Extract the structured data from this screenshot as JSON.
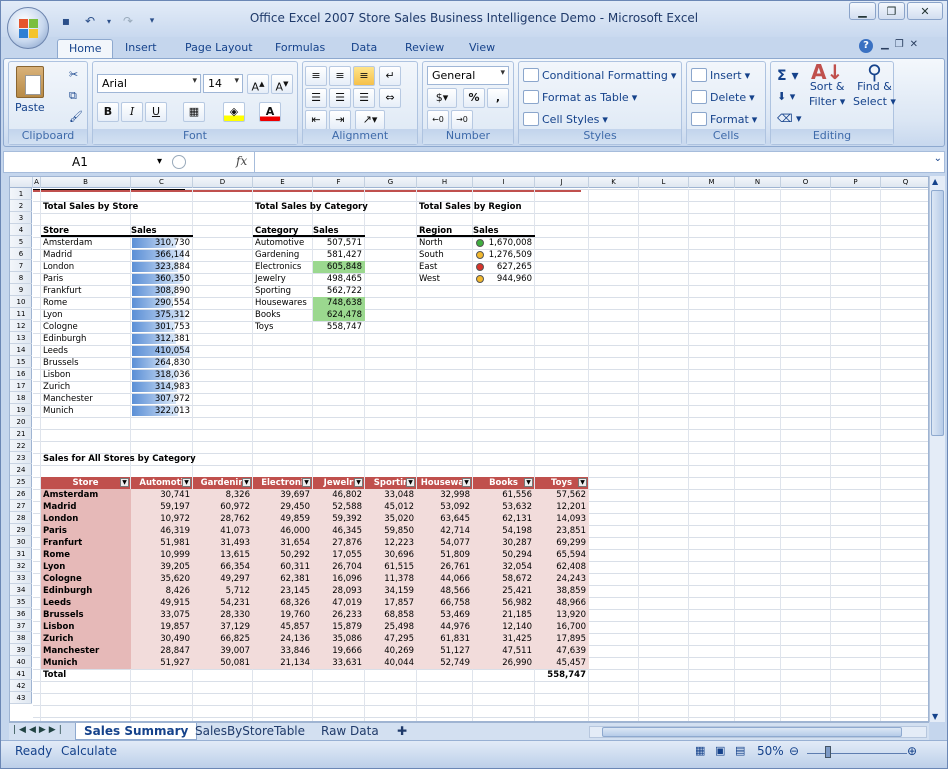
{
  "window": {
    "title": "Office Excel  2007 Store Sales Business Intelligence Demo - Microsoft Excel"
  },
  "tabs": [
    "Home",
    "Insert",
    "Page Layout",
    "Formulas",
    "Data",
    "Review",
    "View"
  ],
  "ribbon": {
    "clipboard": {
      "label": "Clipboard",
      "paste": "Paste"
    },
    "font": {
      "label": "Font",
      "name": "Arial",
      "size": "14"
    },
    "alignment": {
      "label": "Alignment"
    },
    "number": {
      "label": "Number",
      "format": "General",
      "percent": "%",
      "comma": ","
    },
    "styles": {
      "label": "Styles",
      "conditional": "Conditional Formatting",
      "table": "Format as Table",
      "cell": "Cell Styles"
    },
    "cells": {
      "label": "Cells",
      "insert": "Insert",
      "delete": "Delete",
      "format": "Format"
    },
    "editing": {
      "label": "Editing",
      "sort": "Sort &",
      "sort2": "Filter",
      "find": "Find &",
      "find2": "Select"
    }
  },
  "formula_bar": {
    "namebox": "A1",
    "fx": "fx"
  },
  "columns": [
    "A",
    "B",
    "C",
    "D",
    "E",
    "F",
    "G",
    "H",
    "I",
    "J",
    "K",
    "L",
    "M",
    "N",
    "O",
    "P",
    "Q"
  ],
  "rows": [
    "1",
    "2",
    "3",
    "4",
    "5",
    "6",
    "7",
    "8",
    "9",
    "10",
    "11",
    "12",
    "13",
    "14",
    "15",
    "16",
    "17",
    "18",
    "19",
    "20",
    "21",
    "22",
    "23",
    "24",
    "25",
    "26",
    "27",
    "28",
    "29",
    "30",
    "31",
    "32",
    "33",
    "34",
    "35",
    "36",
    "37",
    "38",
    "39",
    "40",
    "41",
    "42",
    "43"
  ],
  "store_summary": {
    "title": "Total Sales by Store",
    "col1": "Store",
    "col2": "Sales",
    "rows": [
      {
        "name": "Amsterdam",
        "value": "310,730",
        "v": 310730
      },
      {
        "name": "Madrid",
        "value": "366,144",
        "v": 366144
      },
      {
        "name": "London",
        "value": "323,884",
        "v": 323884
      },
      {
        "name": "Paris",
        "value": "360,350",
        "v": 360350
      },
      {
        "name": "Frankfurt",
        "value": "308,890",
        "v": 308890
      },
      {
        "name": "Rome",
        "value": "290,554",
        "v": 290554
      },
      {
        "name": "Lyon",
        "value": "375,312",
        "v": 375312
      },
      {
        "name": "Cologne",
        "value": "301,753",
        "v": 301753
      },
      {
        "name": "Edinburgh",
        "value": "312,381",
        "v": 312381
      },
      {
        "name": "Leeds",
        "value": "410,054",
        "v": 410054
      },
      {
        "name": "Brussels",
        "value": "264,830",
        "v": 264830
      },
      {
        "name": "Lisbon",
        "value": "318,036",
        "v": 318036
      },
      {
        "name": "Zurich",
        "value": "314,983",
        "v": 314983
      },
      {
        "name": "Manchester",
        "value": "307,972",
        "v": 307972
      },
      {
        "name": "Munich",
        "value": "322,013",
        "v": 322013
      }
    ]
  },
  "category_summary": {
    "title": "Total Sales by Category",
    "col1": "Category",
    "col2": "Sales",
    "rows": [
      {
        "name": "Automotive",
        "value": "507,571",
        "hl": false
      },
      {
        "name": "Gardening",
        "value": "581,427",
        "hl": false
      },
      {
        "name": "Electronics",
        "value": "605,848",
        "hl": true
      },
      {
        "name": "Jewelry",
        "value": "498,465",
        "hl": false
      },
      {
        "name": "Sporting",
        "value": "562,722",
        "hl": false
      },
      {
        "name": "Housewares",
        "value": "748,638",
        "hl": true
      },
      {
        "name": "Books",
        "value": "624,478",
        "hl": true
      },
      {
        "name": "Toys",
        "value": "558,747",
        "hl": false
      }
    ]
  },
  "region_summary": {
    "title": "Total Sales by Region",
    "col1": "Region",
    "col2": "Sales",
    "rows": [
      {
        "name": "North",
        "value": "1,670,008",
        "color": "#3fae3f"
      },
      {
        "name": "South",
        "value": "1,276,509",
        "color": "#f2b82e"
      },
      {
        "name": "East",
        "value": "627,265",
        "color": "#d8342b"
      },
      {
        "name": "West",
        "value": "944,960",
        "color": "#f2b82e"
      }
    ]
  },
  "all_stores": {
    "title": "Sales for All Stores by Category",
    "headers": [
      "Store",
      "Automoti",
      "Gardenin",
      "Electroni",
      "Jewelr",
      "Sportir",
      "Housewar",
      "Books",
      "Toys"
    ],
    "rows": [
      [
        "Amsterdam",
        "30,741",
        "8,326",
        "39,697",
        "46,802",
        "33,048",
        "32,998",
        "61,556",
        "57,562"
      ],
      [
        "Madrid",
        "59,197",
        "60,972",
        "29,450",
        "52,588",
        "45,012",
        "53,092",
        "53,632",
        "12,201"
      ],
      [
        "London",
        "10,972",
        "28,762",
        "49,859",
        "59,392",
        "35,020",
        "63,645",
        "62,131",
        "14,093"
      ],
      [
        "Paris",
        "46,319",
        "41,073",
        "46,000",
        "46,345",
        "59,850",
        "42,714",
        "54,198",
        "23,851"
      ],
      [
        "Franfurt",
        "51,981",
        "31,493",
        "31,654",
        "27,876",
        "12,223",
        "54,077",
        "30,287",
        "69,299"
      ],
      [
        "Rome",
        "10,999",
        "13,615",
        "50,292",
        "17,055",
        "30,696",
        "51,809",
        "50,294",
        "65,594"
      ],
      [
        "Lyon",
        "39,205",
        "66,354",
        "60,311",
        "26,704",
        "61,515",
        "26,761",
        "32,054",
        "62,408"
      ],
      [
        "Cologne",
        "35,620",
        "49,297",
        "62,381",
        "16,096",
        "11,378",
        "44,066",
        "58,672",
        "24,243"
      ],
      [
        "Edinburgh",
        "8,426",
        "5,712",
        "23,145",
        "28,093",
        "34,159",
        "48,566",
        "25,421",
        "38,859"
      ],
      [
        "Leeds",
        "49,915",
        "54,231",
        "68,326",
        "47,019",
        "17,857",
        "66,758",
        "56,982",
        "48,966"
      ],
      [
        "Brussels",
        "33,075",
        "28,330",
        "19,760",
        "26,233",
        "68,858",
        "53,469",
        "21,185",
        "13,920"
      ],
      [
        "Lisbon",
        "19,857",
        "37,129",
        "45,857",
        "15,879",
        "25,498",
        "44,976",
        "12,140",
        "16,700"
      ],
      [
        "Zurich",
        "30,490",
        "66,825",
        "24,136",
        "35,086",
        "47,295",
        "61,831",
        "31,425",
        "17,895"
      ],
      [
        "Manchester",
        "28,847",
        "39,007",
        "33,846",
        "19,666",
        "40,269",
        "51,127",
        "47,511",
        "47,639"
      ],
      [
        "Munich",
        "51,927",
        "50,081",
        "21,134",
        "33,631",
        "40,044",
        "52,749",
        "26,990",
        "45,457"
      ]
    ],
    "total_label": "Total",
    "total_value": "558,747"
  },
  "sheets": [
    "Sales Summary",
    "SalesByStoreTable",
    "Raw Data"
  ],
  "status": {
    "ready": "Ready",
    "calc": "Calculate",
    "zoom": "50%"
  }
}
